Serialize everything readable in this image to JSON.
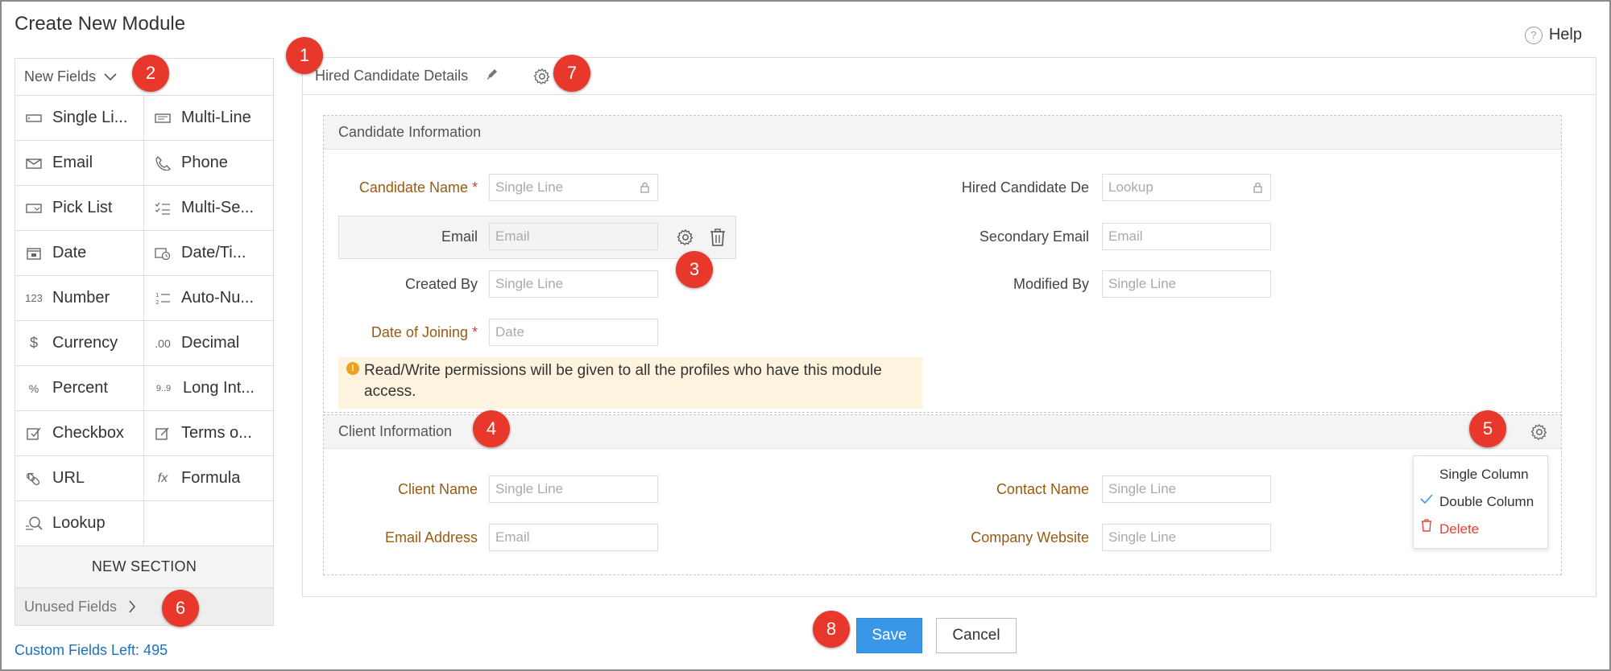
{
  "window": {
    "title": "Create New Module",
    "help_label": "Help"
  },
  "palette": {
    "header": "New Fields",
    "fields": [
      {
        "label": "Single Li...",
        "icon": "single-line-icon"
      },
      {
        "label": "Multi-Line",
        "icon": "multi-line-icon"
      },
      {
        "label": "Email",
        "icon": "email-icon"
      },
      {
        "label": "Phone",
        "icon": "phone-icon"
      },
      {
        "label": "Pick List",
        "icon": "picklist-icon"
      },
      {
        "label": "Multi-Se...",
        "icon": "multi-select-icon"
      },
      {
        "label": "Date",
        "icon": "date-icon"
      },
      {
        "label": "Date/Ti...",
        "icon": "datetime-icon"
      },
      {
        "label": "Number",
        "icon": "number-icon"
      },
      {
        "label": "Auto-Nu...",
        "icon": "auto-number-icon"
      },
      {
        "label": "Currency",
        "icon": "currency-icon"
      },
      {
        "label": "Decimal",
        "icon": "decimal-icon"
      },
      {
        "label": "Percent",
        "icon": "percent-icon"
      },
      {
        "label": "Long Int...",
        "icon": "long-integer-icon"
      },
      {
        "label": "Checkbox",
        "icon": "checkbox-icon"
      },
      {
        "label": "Terms o...",
        "icon": "terms-icon"
      },
      {
        "label": "URL",
        "icon": "url-icon"
      },
      {
        "label": "Formula",
        "icon": "formula-icon"
      },
      {
        "label": "Lookup",
        "icon": "lookup-icon"
      }
    ],
    "new_section": "NEW SECTION",
    "unused_fields": "Unused Fields",
    "custom_fields_left": "Custom Fields Left: 495"
  },
  "module": {
    "name": "Hired Candidate Details",
    "sections": [
      {
        "title": "Candidate Information",
        "left_fields": [
          {
            "label": "Candidate Name",
            "placeholder": "Single Line",
            "required": true,
            "locked": true
          },
          {
            "label": "Email",
            "placeholder": "Email"
          },
          {
            "label": "Created By",
            "placeholder": "Single Line"
          },
          {
            "label": "Date of Joining",
            "placeholder": "Date",
            "required": true
          }
        ],
        "right_fields": [
          {
            "label": "Hired Candidate De",
            "placeholder": "Lookup",
            "locked": true
          },
          {
            "label": "Secondary Email",
            "placeholder": "Email"
          },
          {
            "label": "Modified By",
            "placeholder": "Single Line"
          }
        ],
        "notice": "Read/Write permissions will be given to all the profiles who have this module access."
      },
      {
        "title": "Client Information",
        "left_fields": [
          {
            "label": "Client Name",
            "placeholder": "Single Line"
          },
          {
            "label": "Email Address",
            "placeholder": "Email"
          }
        ],
        "right_fields": [
          {
            "label": "Contact Name",
            "placeholder": "Single Line"
          },
          {
            "label": "Company Website",
            "placeholder": "Single Line"
          }
        ]
      }
    ],
    "section_menu": {
      "single_column": "Single Column",
      "double_column": "Double Column",
      "delete": "Delete"
    }
  },
  "badges": [
    "1",
    "2",
    "3",
    "4",
    "5",
    "6",
    "7",
    "8"
  ],
  "actions": {
    "save": "Save",
    "cancel": "Cancel"
  },
  "colors": {
    "badge": "#e8382b",
    "save": "#3a97e8",
    "link": "#1d6fc2",
    "mandatory_label": "#9a5a12",
    "delete": "#e0443b",
    "notice_bg": "#fef3de"
  }
}
